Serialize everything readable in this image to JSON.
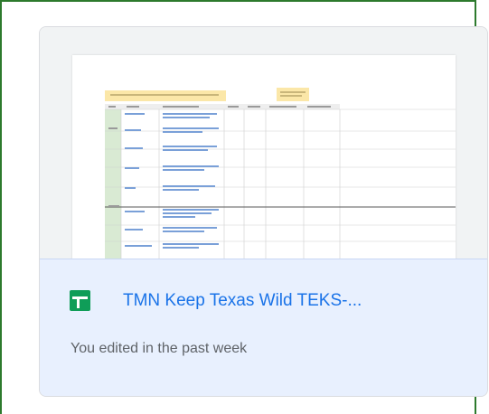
{
  "card": {
    "title": "TMN Keep Texas Wild TEKS-...",
    "subtitle": "You edited in the past week",
    "file_type_icon": "google-sheets-icon",
    "title_color": "#1a73e8",
    "icon_color": "#0f9d58",
    "footer_bg": "#e8f0fe"
  }
}
